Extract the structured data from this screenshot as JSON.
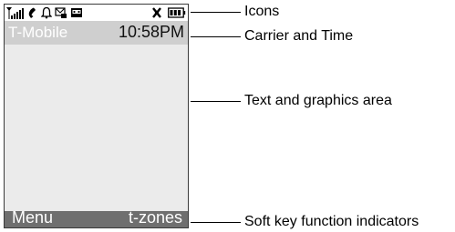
{
  "screen": {
    "icons": [
      "signal-strength-icon",
      "call-icon",
      "alarm-icon",
      "message-icon",
      "voicemail-icon",
      "vibrate-icon",
      "battery-icon"
    ],
    "carrier": "T-Mobile",
    "time": "10:58PM",
    "softkey_left": "Menu",
    "softkey_right": "t-zones"
  },
  "callouts": {
    "icons": "Icons",
    "carrier_time": "Carrier and Time",
    "text_area": "Text and graphics area",
    "softkeys": "Soft key function indicators"
  }
}
